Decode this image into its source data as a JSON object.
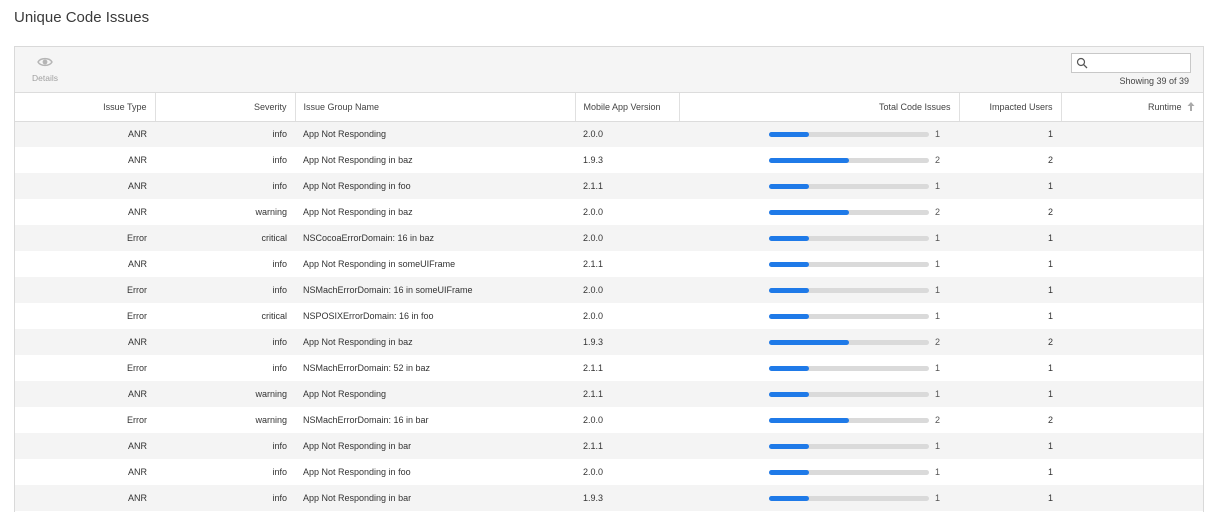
{
  "page": {
    "title": "Unique Code Issues"
  },
  "toolbar": {
    "details_label": "Details",
    "search_placeholder": "",
    "showing_text": "Showing 39 of 39"
  },
  "table": {
    "headers": {
      "issue_type": "Issue Type",
      "severity": "Severity",
      "issue_group_name": "Issue Group Name",
      "mobile_app_version": "Mobile App Version",
      "total_code_issues": "Total Code Issues",
      "impacted_users": "Impacted Users",
      "runtime": "Runtime"
    },
    "total_max": 4,
    "rows": [
      {
        "issue_type": "ANR",
        "severity": "info",
        "group": "App Not Responding",
        "version": "2.0.0",
        "total": 1,
        "users": "1",
        "runtime": ""
      },
      {
        "issue_type": "ANR",
        "severity": "info",
        "group": "App Not Responding in baz",
        "version": "1.9.3",
        "total": 2,
        "users": "2",
        "runtime": ""
      },
      {
        "issue_type": "ANR",
        "severity": "info",
        "group": "App Not Responding in foo",
        "version": "2.1.1",
        "total": 1,
        "users": "1",
        "runtime": ""
      },
      {
        "issue_type": "ANR",
        "severity": "warning",
        "group": "App Not Responding in baz",
        "version": "2.0.0",
        "total": 2,
        "users": "2",
        "runtime": ""
      },
      {
        "issue_type": "Error",
        "severity": "critical",
        "group": "NSCocoaErrorDomain: 16 in baz",
        "version": "2.0.0",
        "total": 1,
        "users": "1",
        "runtime": ""
      },
      {
        "issue_type": "ANR",
        "severity": "info",
        "group": "App Not Responding in someUIFrame",
        "version": "2.1.1",
        "total": 1,
        "users": "1",
        "runtime": ""
      },
      {
        "issue_type": "Error",
        "severity": "info",
        "group": "NSMachErrorDomain: 16 in someUIFrame",
        "version": "2.0.0",
        "total": 1,
        "users": "1",
        "runtime": ""
      },
      {
        "issue_type": "Error",
        "severity": "critical",
        "group": "NSPOSIXErrorDomain: 16 in foo",
        "version": "2.0.0",
        "total": 1,
        "users": "1",
        "runtime": ""
      },
      {
        "issue_type": "ANR",
        "severity": "info",
        "group": "App Not Responding in baz",
        "version": "1.9.3",
        "total": 2,
        "users": "2",
        "runtime": ""
      },
      {
        "issue_type": "Error",
        "severity": "info",
        "group": "NSMachErrorDomain: 52 in baz",
        "version": "2.1.1",
        "total": 1,
        "users": "1",
        "runtime": ""
      },
      {
        "issue_type": "ANR",
        "severity": "warning",
        "group": "App Not Responding",
        "version": "2.1.1",
        "total": 1,
        "users": "1",
        "runtime": ""
      },
      {
        "issue_type": "Error",
        "severity": "warning",
        "group": "NSMachErrorDomain: 16 in bar",
        "version": "2.0.0",
        "total": 2,
        "users": "2",
        "runtime": ""
      },
      {
        "issue_type": "ANR",
        "severity": "info",
        "group": "App Not Responding in bar",
        "version": "2.1.1",
        "total": 1,
        "users": "1",
        "runtime": ""
      },
      {
        "issue_type": "ANR",
        "severity": "info",
        "group": "App Not Responding in foo",
        "version": "2.0.0",
        "total": 1,
        "users": "1",
        "runtime": ""
      },
      {
        "issue_type": "ANR",
        "severity": "info",
        "group": "App Not Responding in bar",
        "version": "1.9.3",
        "total": 1,
        "users": "1",
        "runtime": ""
      }
    ]
  },
  "colors": {
    "bar_fill": "#1f7ae8",
    "bar_track": "#dadada",
    "stripe": "#f4f4f4"
  },
  "icons": {
    "details": "eye-icon",
    "search": "search-icon",
    "sort": "sort-ascending-icon"
  }
}
